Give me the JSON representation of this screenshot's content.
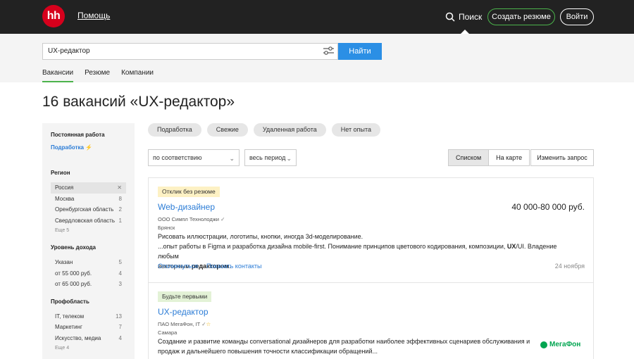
{
  "header": {
    "logo": "hh",
    "home": "Помощь",
    "search": "Поиск",
    "create_resume": "Создать резюме",
    "login": "Войти"
  },
  "search": {
    "value": "UX-редактор",
    "button": "Найти",
    "tabs": [
      "Вакансии",
      "Резюме",
      "Компании"
    ]
  },
  "page_title": "16 вакансий «UX-редактор»",
  "sidebar": {
    "employment_title": "Постоянная работа",
    "employment_link": "Подработка",
    "region_title": "Регион",
    "regions": [
      {
        "label": "Россия",
        "count": "✕"
      },
      {
        "label": "Москва",
        "count": "8"
      },
      {
        "label": "Оренбургская область",
        "count": "2"
      },
      {
        "label": "Свердловская область",
        "count": "1"
      }
    ],
    "region_more": "Еще 5",
    "income_title": "Уровень дохода",
    "incomes": [
      {
        "label": "Указан",
        "count": "5"
      },
      {
        "label": "от 55 000 руб.",
        "count": "4"
      },
      {
        "label": "от 65 000 руб.",
        "count": "3"
      }
    ],
    "prof_title": "Профобласть",
    "profs": [
      {
        "label": "IT, телеком",
        "count": "13"
      },
      {
        "label": "Маркетинг",
        "count": "7"
      },
      {
        "label": "Искусство, медиа",
        "count": "4"
      }
    ],
    "prof_more": "Еще 4"
  },
  "chips": [
    "Подработка",
    "Свежие",
    "Удаленная работа",
    "Нет опыта"
  ],
  "controls": {
    "sort": "по соответствию",
    "period": "весь период",
    "view_list": "Списком",
    "view_map": "На карте",
    "edit": "Изменить запрос"
  },
  "vacancies": [
    {
      "badge": "Отклик без резюме",
      "title": "Web-дизайнер",
      "salary": "40 000-80 000 руб.",
      "company": "ООО Симпл Технолоджи",
      "city": "Брянск",
      "line1": "Рисовать иллюстрации, логотипы, кнопки, иногда 3d-моделирование.",
      "line2a": "...опыт работы в Figma и разработка дизайна mobile-first. Понимание принципов цветового кодирования, композиции, ",
      "line2b": "UX",
      "line2c": "/UI. Владение любым",
      "line3a": "векторным ",
      "line3b": "редактором",
      "line3c": ".",
      "apply": "Откликнуться",
      "contacts": "Показать контакты",
      "date": "24 ноября"
    },
    {
      "badge": "Будьте первыми",
      "title": "UX-редактор",
      "company": "ПАО МегаФон, IT",
      "city": "Самара",
      "line1": "Создание и развитие команды conversational дизайнеров для разработки наиболее эффективных сценариев обслуживания и",
      "line2": "продаж и дальнейшего повышения точности классификации обращений...",
      "logo_text": "МегаФон"
    }
  ],
  "colors": {
    "accent_green": "#4bb34b",
    "link_blue": "#2b7cd6",
    "button_blue": "#2b8fe5",
    "brand_red": "#d6001c",
    "megafon_green": "#00a550"
  }
}
